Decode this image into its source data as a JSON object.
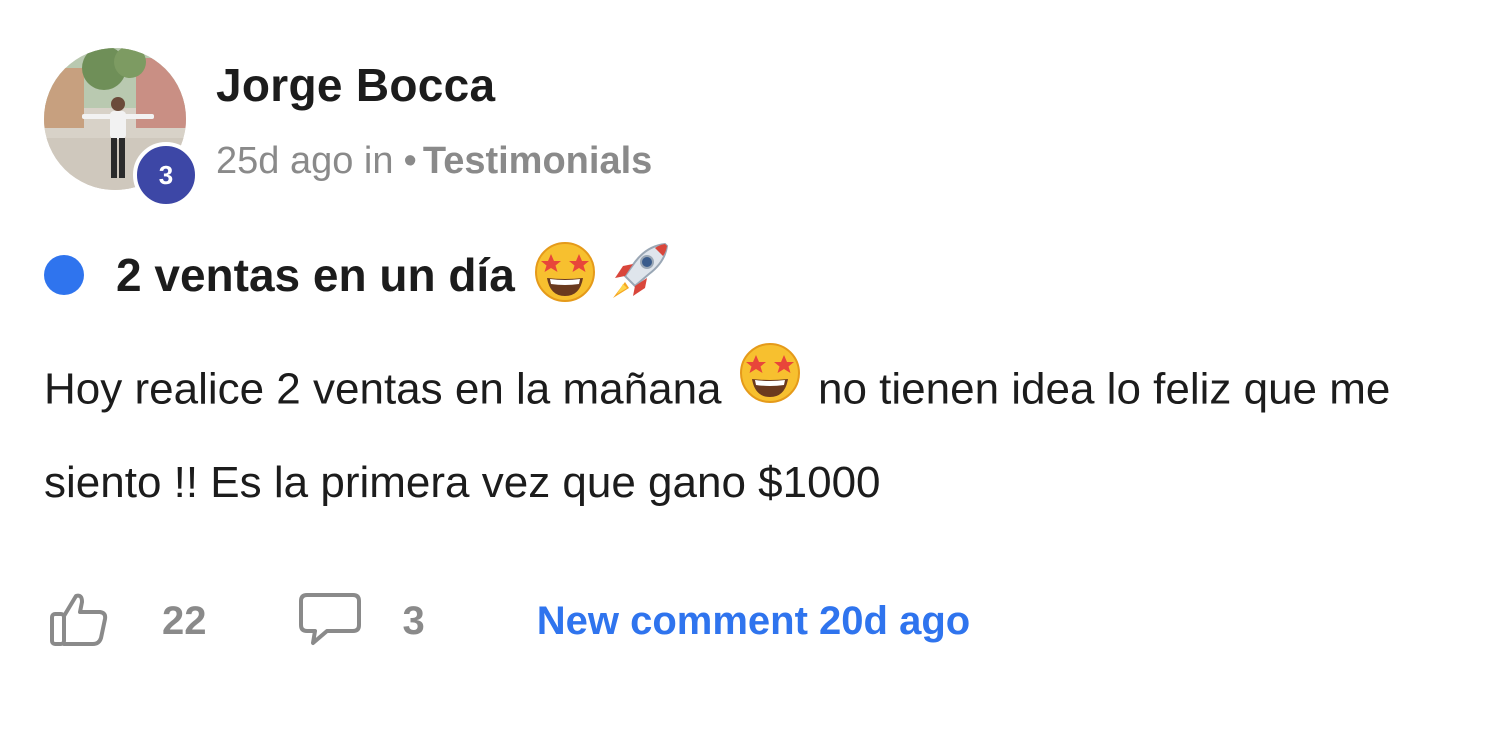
{
  "post": {
    "author": "Jorge Bocca",
    "level": "3",
    "time": "25d ago in",
    "separator": "•",
    "category": "Testimonials",
    "title": "2 ventas en un día",
    "title_emojis": [
      "star-struck-emoji",
      "rocket-emoji"
    ],
    "body_part1": "Hoy realice 2 ventas en la mañana",
    "body_emoji": "star-struck-emoji",
    "body_part2": "no tienen idea lo feliz que me siento !! Es la primera vez que gano $1000",
    "likes": "22",
    "comments": "3",
    "new_comment": "New comment 20d ago"
  },
  "colors": {
    "accent_blue": "#2f74ee",
    "level_badge": "#3d47a6",
    "muted_text": "#8a8a8a",
    "primary_text": "#1c1c1c"
  },
  "icons": {
    "like": "thumbs-up-icon",
    "comment": "comment-bubble-icon",
    "unread": "unread-dot-icon"
  }
}
